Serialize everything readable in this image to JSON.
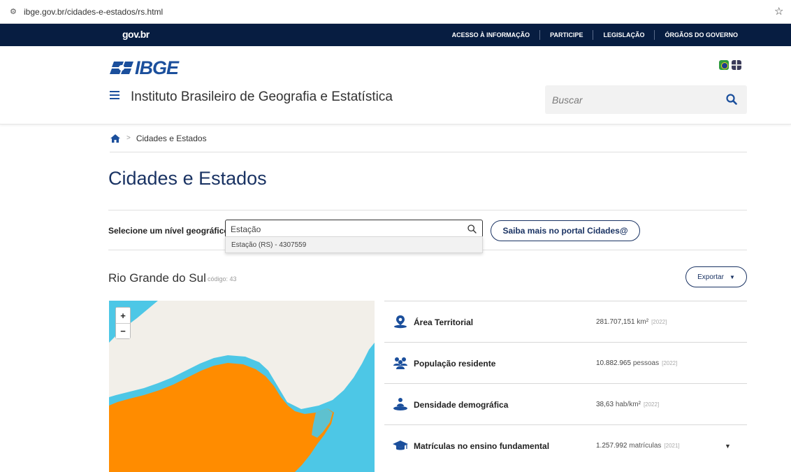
{
  "browser": {
    "url": "ibge.gov.br/cidades-e-estados/rs.html"
  },
  "govbar": {
    "logo": "gov.br",
    "links": [
      "ACESSO À INFORMAÇÃO",
      "PARTICIPE",
      "LEGISLAÇÃO",
      "ÓRGÃOS DO GOVERNO"
    ]
  },
  "header": {
    "logo_text": "IBGE",
    "institute": "Instituto Brasileiro de Geografia e Estatística",
    "search_placeholder": "Buscar"
  },
  "breadcrumb": {
    "current": "Cidades e Estados"
  },
  "page": {
    "title": "Cidades e Estados",
    "selector_label": "Selecione um nível geográfico",
    "selector_value": "Estação",
    "dropdown_option": "Estação (RS) - 4307559",
    "portal_button": "Saiba mais no portal Cidades@"
  },
  "state": {
    "name": "Rio Grande do Sul",
    "code": "código: 43",
    "export_label": "Exportar"
  },
  "stats": [
    {
      "label": "Área Territorial",
      "value": "281.707,151",
      "unit": "km²",
      "year": "[2022]",
      "icon": "map-pin-icon"
    },
    {
      "label": "População residente",
      "value": "10.882.965",
      "unit": "pessoas",
      "year": "[2022]",
      "icon": "people-icon"
    },
    {
      "label": "Densidade demográfica",
      "value": "38,63",
      "unit": "hab/km²",
      "year": "[2022]",
      "icon": "person-area-icon"
    },
    {
      "label": "Matrículas no ensino fundamental",
      "value": "1.257.992",
      "unit": "matrículas",
      "year": "[2021]",
      "icon": "graduation-cap-icon"
    }
  ],
  "colors": {
    "govbar": "#071d41",
    "brand": "#1b4f9c",
    "title": "#1a3363",
    "map_water": "#4dc7e6",
    "map_land": "#f2efe9",
    "map_state": "#ff8c00"
  }
}
